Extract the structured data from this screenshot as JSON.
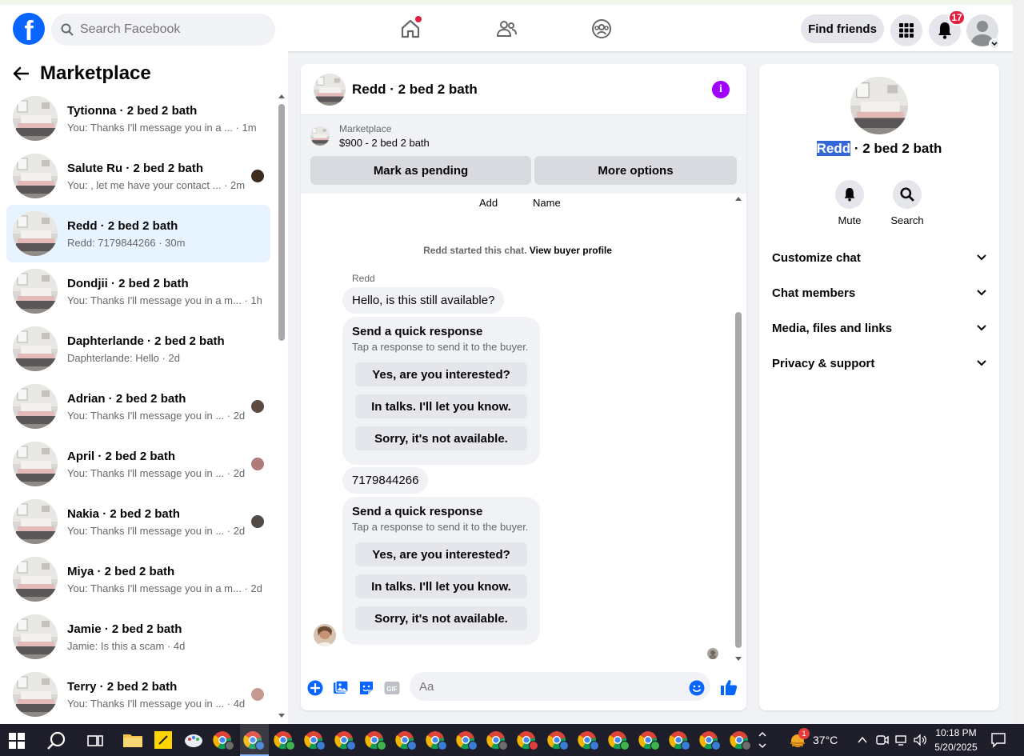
{
  "topbar": {
    "logo": "f",
    "search_placeholder": "Search Facebook",
    "find_friends": "Find friends",
    "notification_count": "17"
  },
  "left": {
    "title": "Marketplace",
    "conversations": [
      {
        "title": "Tytionna · 2 bed 2 bath",
        "sub": "You: Thanks I'll message you in a ... · 1m"
      },
      {
        "title": "Salute Ru · 2 bed 2 bath",
        "sub": "You: , let me have your contact ... · 2m"
      },
      {
        "title": "Redd · 2 bed 2 bath",
        "sub": "Redd: 7179844266 · 30m"
      },
      {
        "title": "Dondjii · 2 bed 2 bath",
        "sub": "You: Thanks I'll message you in a m... · 1h"
      },
      {
        "title": "Daphterlande · 2 bed 2 bath",
        "sub": "Daphterlande: Hello · 2d"
      },
      {
        "title": "Adrian · 2 bed 2 bath",
        "sub": "You: Thanks I'll message you in ... · 2d"
      },
      {
        "title": "April · 2 bed 2 bath",
        "sub": "You: Thanks I'll message you in ... · 2d"
      },
      {
        "title": "Nakia · 2 bed 2 bath",
        "sub": "You: Thanks I'll message you in ... · 2d"
      },
      {
        "title": "Miya · 2 bed 2 bath",
        "sub": "You: Thanks I'll message you in a m... · 2d"
      },
      {
        "title": "Jamie · 2 bed 2 bath",
        "sub": "Jamie: Is this a scam · 4d"
      },
      {
        "title": "Terry · 2 bed 2 bath",
        "sub": "You: Thanks I'll message you in ... · 4d"
      }
    ]
  },
  "chat": {
    "title": "Redd · 2 bed 2 bath",
    "marketplace_label": "Marketplace",
    "listing": "$900 - 2 bed 2 bath",
    "mark_pending": "Mark as pending",
    "more_options": "More options",
    "col_add": "Add",
    "col_name": "Name",
    "started_text": "Redd started this chat.",
    "view_buyer": "View buyer profile",
    "sender": "Redd",
    "msg1": "Hello, is this still available?",
    "qr_title": "Send a quick response",
    "qr_sub": "Tap a response to send it to the buyer.",
    "qr_options": [
      "Yes, are you interested?",
      "In talks. I'll let you know.",
      "Sorry, it's not available."
    ],
    "msg2": "7179844266",
    "composer_placeholder": "Aa"
  },
  "right": {
    "name_selected": "Redd",
    "name_rest": " · 2 bed 2 bath",
    "mute": "Mute",
    "search": "Search",
    "sections": [
      "Customize chat",
      "Chat members",
      "Media, files and links",
      "Privacy & support"
    ]
  },
  "taskbar": {
    "temperature": "37°C",
    "time": "10:18 PM",
    "date": "5/20/2025",
    "weather_badge": "1"
  },
  "colors": {
    "brand": "#0866ff",
    "active_row": "#e7f3ff",
    "info_purple": "#a100ff",
    "badge_red": "#e41e3f"
  }
}
